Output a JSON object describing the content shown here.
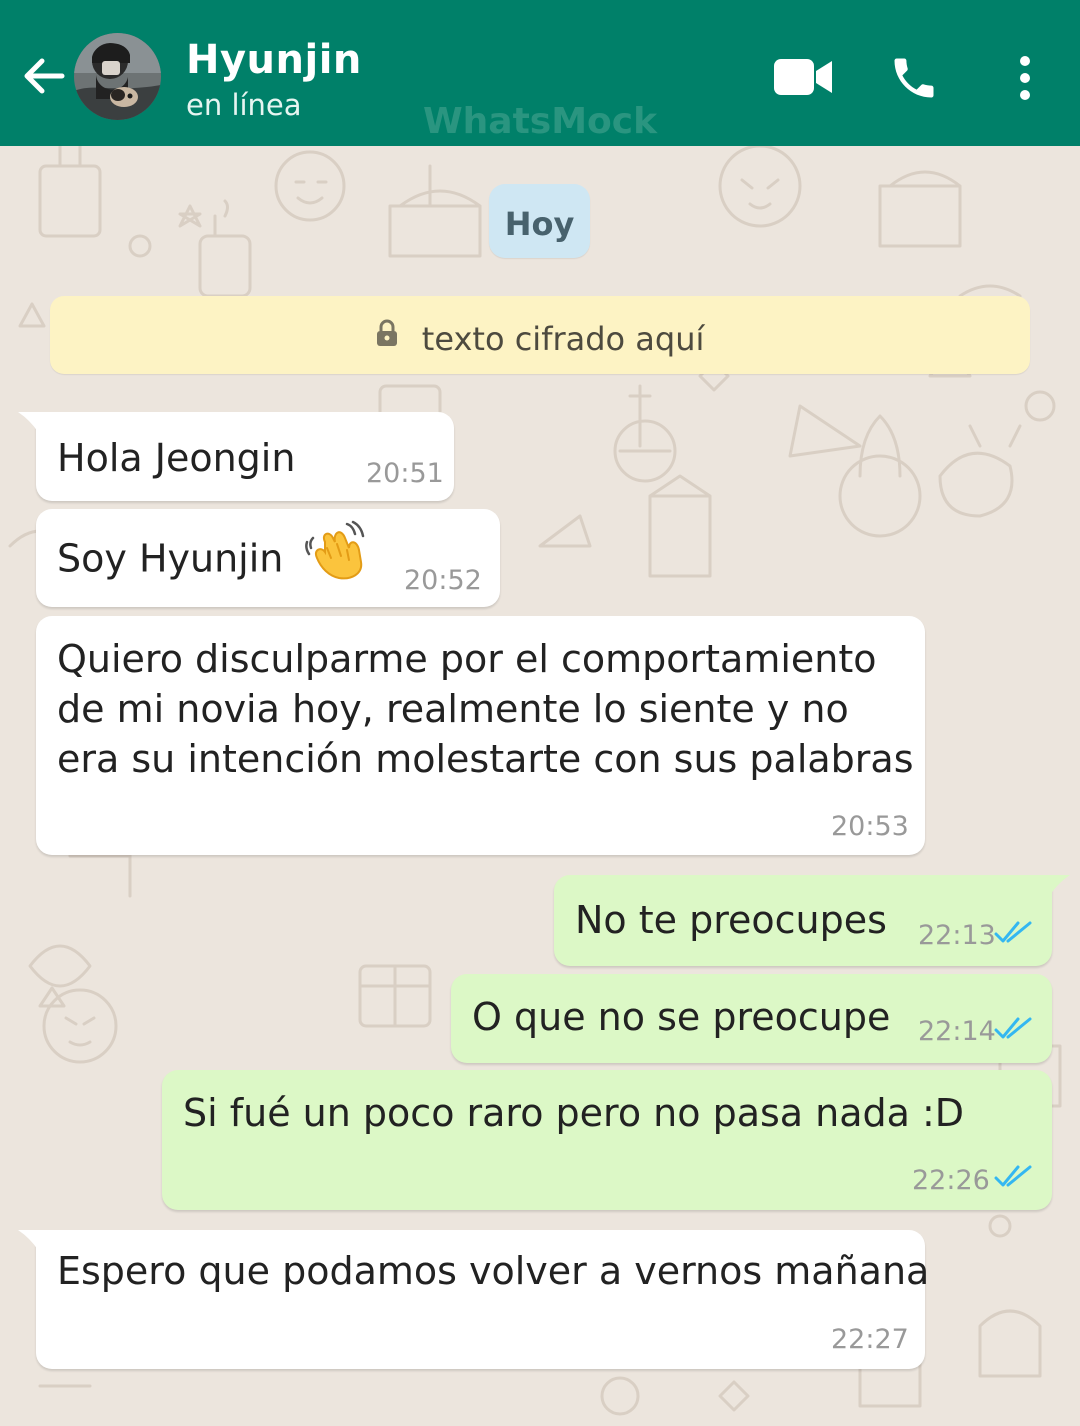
{
  "header": {
    "contact_name": "Hyunjin",
    "contact_status": "en línea",
    "watermark": "WhatsMock",
    "bg_color": "#008069"
  },
  "chat": {
    "date_label": "Hoy",
    "encryption_notice": "texto cifrado aquí",
    "incoming_bubble_color": "#ffffff",
    "outgoing_bubble_color": "#dcf8c6",
    "read_tick_color": "#34b7f1",
    "messages": [
      {
        "direction": "in",
        "text": "Hola Jeongin",
        "time": "20:51"
      },
      {
        "direction": "in",
        "text": "Soy Hyunjin",
        "emoji": "waving-hand",
        "time": "20:52"
      },
      {
        "direction": "in",
        "lines": [
          "Quiero disculparme por el comportamiento",
          "de mi novia hoy, realmente lo siente y no",
          "era su intención molestarte con sus palabras"
        ],
        "time": "20:53"
      },
      {
        "direction": "out",
        "text": "No te preocupes",
        "time": "22:13",
        "status": "read"
      },
      {
        "direction": "out",
        "text": "O que no se preocupe",
        "time": "22:14",
        "status": "read"
      },
      {
        "direction": "out",
        "text": "Si fué un poco raro pero no pasa nada :D",
        "time": "22:26",
        "status": "read"
      },
      {
        "direction": "in",
        "text": "Espero que podamos volver a vernos mañana",
        "time": "22:27"
      }
    ]
  },
  "icons": {
    "back": "arrow-left-icon",
    "video": "video-camera-icon",
    "call": "phone-icon",
    "menu": "more-vertical-icon",
    "lock": "lock-icon",
    "ticks": "double-check-icon"
  }
}
